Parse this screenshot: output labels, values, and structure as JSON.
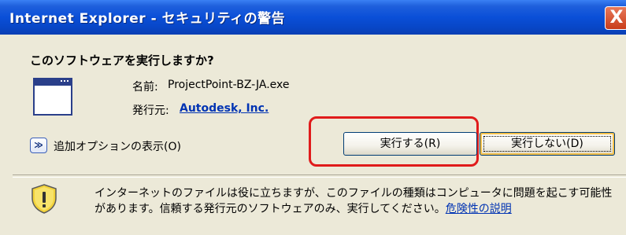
{
  "window": {
    "title": "Internet Explorer - セキュリティの警告",
    "close_label": "X"
  },
  "dialog": {
    "headline": "このソフトウェアを実行しますか?",
    "name_label": "名前:",
    "name_value": "ProjectPoint-BZ-JA.exe",
    "publisher_label": "発行元:",
    "publisher_value": "Autodesk, Inc.",
    "more_options_icon": "≫",
    "more_options_label": "追加オプションの表示(O)",
    "run_button": "実行する(R)",
    "dont_run_button": "実行しない(D)"
  },
  "warning": {
    "text": "インターネットのファイルは役に立ちますが、このファイルの種類はコンピュータに問題を起こす可能性があります。信頼する発行元のソフトウェアのみ、実行してください。",
    "link_text": "危険性の説明",
    "icon": "shield-warning-icon"
  },
  "colors": {
    "titlebar": "#0a4fd8",
    "highlight": "#e01b1b",
    "link": "#0033b3"
  }
}
